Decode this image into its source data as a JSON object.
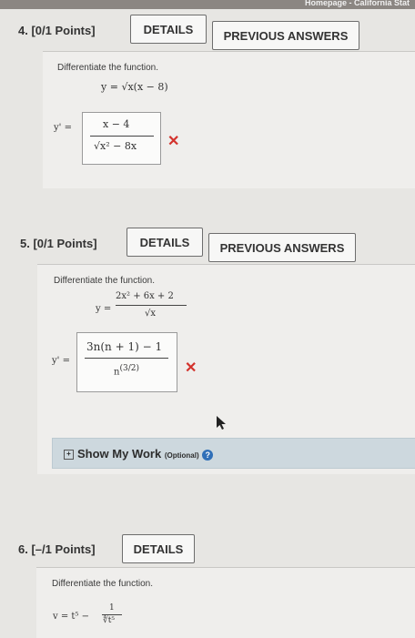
{
  "browser": {
    "tab_hint": "Homepage - California Stat"
  },
  "questions": [
    {
      "number_label": "4.",
      "points_label": "[0/1 Points]",
      "details_label": "DETAILS",
      "previous_label": "PREVIOUS ANSWERS",
      "prompt": "Differentiate the function.",
      "function_lhs": "y =",
      "function_rhs": "√x(x − 8)",
      "answer_lhs": "y' =",
      "answer_num": "x − 4",
      "answer_den": "√x² − 8x",
      "status": "incorrect"
    },
    {
      "number_label": "5.",
      "points_label": "[0/1 Points]",
      "details_label": "DETAILS",
      "previous_label": "PREVIOUS ANSWERS",
      "prompt": "Differentiate the function.",
      "function_lhs": "y =",
      "function_num": "2x² + 6x + 2",
      "function_den": "√x",
      "answer_lhs": "y' =",
      "answer_num": "3n(n + 1) − 1",
      "answer_den": "n",
      "answer_den_exp": "(3/2)",
      "status": "incorrect",
      "show_work_label": "Show My Work",
      "show_work_optional": "(Optional)",
      "help_icon": "?"
    },
    {
      "number_label": "6.",
      "points_label": "[–/1 Points]",
      "details_label": "DETAILS",
      "prompt": "Differentiate the function.",
      "function_lhs": "v =",
      "function_term": "t⁵ −",
      "function_num": "1",
      "function_den": "∜t⁵"
    }
  ],
  "colors": {
    "incorrect": "#d3322c",
    "help": "#2f6fb8"
  }
}
